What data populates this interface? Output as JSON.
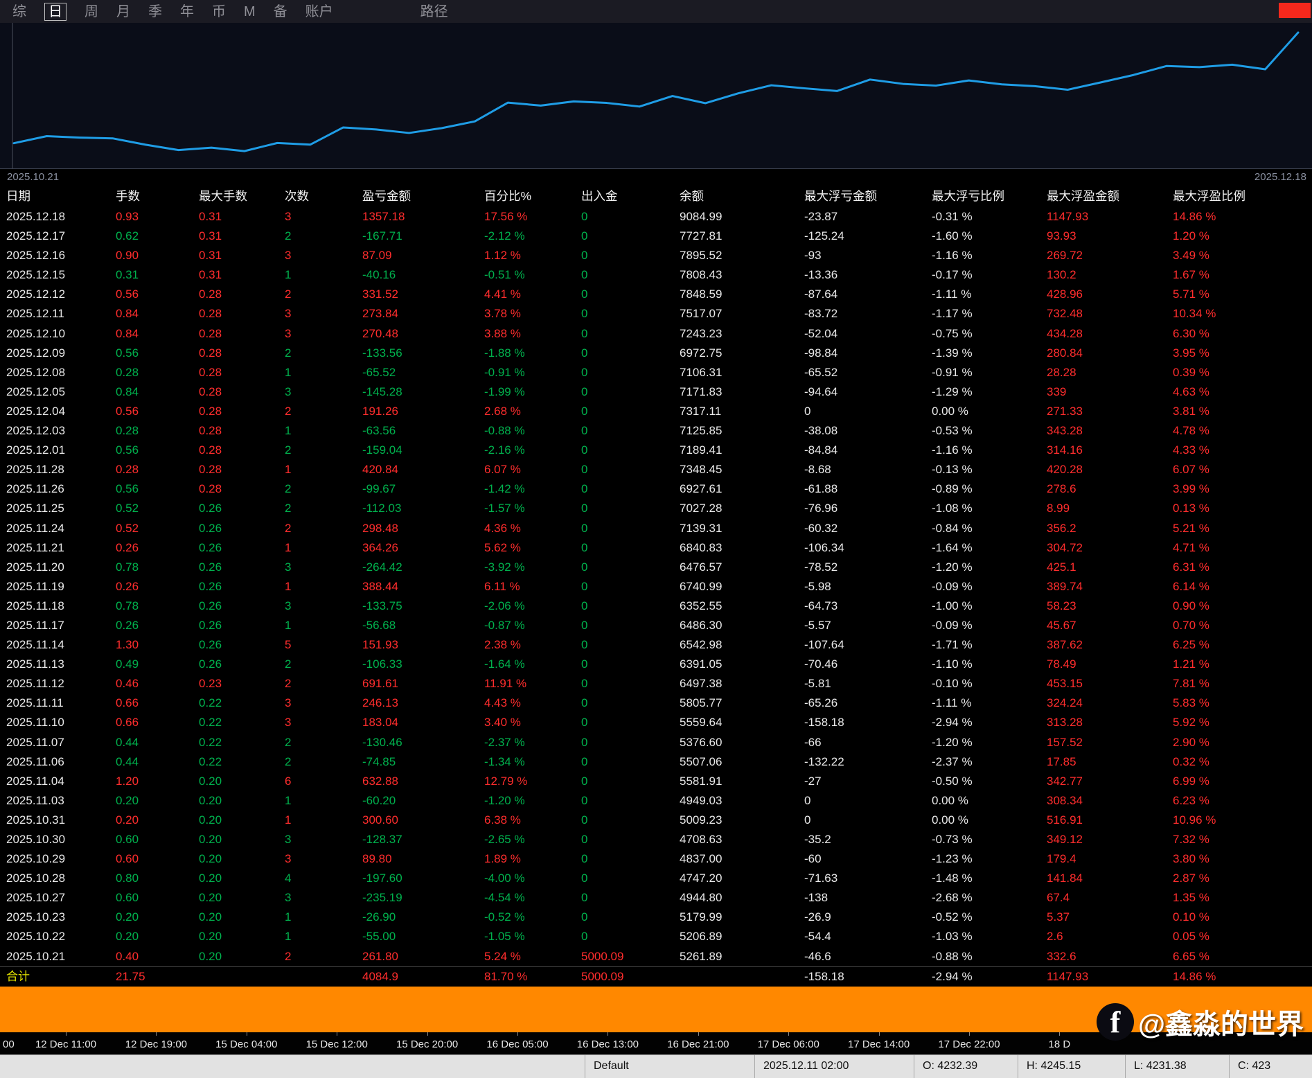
{
  "menu": {
    "items": [
      {
        "label": "综",
        "active": false
      },
      {
        "label": "日",
        "active": true
      },
      {
        "label": "周",
        "active": false
      },
      {
        "label": "月",
        "active": false
      },
      {
        "label": "季",
        "active": false
      },
      {
        "label": "年",
        "active": false
      },
      {
        "label": "币",
        "active": false
      },
      {
        "label": "M",
        "active": false
      },
      {
        "label": "备",
        "active": false
      },
      {
        "label": "账户",
        "active": false
      },
      {
        "label": "路径",
        "active": false,
        "gap": 100
      }
    ]
  },
  "chart": {
    "label_left": "2025.10.21",
    "label_right": "2025.12.18",
    "line_color": "#1f9de6"
  },
  "chart_data": {
    "type": "line",
    "name": "余额",
    "x_start": "2025.10.21",
    "x_end": "2025.12.18",
    "ylim": [
      4708.63,
      9084.99
    ],
    "values": [
      5000.09,
      5261.89,
      5206.89,
      5179.99,
      4944.8,
      4747.2,
      4837.0,
      4708.63,
      5009.23,
      4949.03,
      5581.91,
      5507.06,
      5376.6,
      5559.64,
      5805.77,
      6497.38,
      6391.05,
      6542.98,
      6486.3,
      6352.55,
      6740.99,
      6476.57,
      6840.83,
      7139.31,
      7027.28,
      6927.61,
      7348.45,
      7189.41,
      7125.85,
      7317.11,
      7171.83,
      7106.31,
      6972.75,
      7243.23,
      7517.07,
      7848.59,
      7808.43,
      7895.52,
      7727.81,
      9084.99
    ]
  },
  "table": {
    "keys": [
      "date",
      "lots",
      "max_lots",
      "count",
      "pnl",
      "pct",
      "deposit",
      "balance",
      "max_float_loss",
      "max_float_loss_pct",
      "max_float_profit",
      "max_float_profit_pct"
    ],
    "headers": [
      "日期",
      "手数",
      "最大手数",
      "次数",
      "盈亏金额",
      "百分比%",
      "出入金",
      "余额",
      "最大浮亏金额",
      "最大浮亏比例",
      "最大浮盈金额",
      "最大浮盈比例"
    ],
    "rows": [
      {
        "cells": [
          "2025.12.18",
          "0.93",
          "0.31",
          "3",
          "1357.18",
          "17.56 %",
          "0",
          "9084.99",
          "-23.87",
          "-0.31 %",
          "1147.93",
          "14.86 %"
        ],
        "colors": "wrrrrrgwwwrr"
      },
      {
        "cells": [
          "2025.12.17",
          "0.62",
          "0.31",
          "2",
          "-167.71",
          "-2.12 %",
          "0",
          "7727.81",
          "-125.24",
          "-1.60 %",
          "93.93",
          "1.20 %"
        ],
        "colors": "wgrggggwwwrr"
      },
      {
        "cells": [
          "2025.12.16",
          "0.90",
          "0.31",
          "3",
          "87.09",
          "1.12 %",
          "0",
          "7895.52",
          "-93",
          "-1.16 %",
          "269.72",
          "3.49 %"
        ],
        "colors": "wrrrrrgwwwrr"
      },
      {
        "cells": [
          "2025.12.15",
          "0.31",
          "0.31",
          "1",
          "-40.16",
          "-0.51 %",
          "0",
          "7808.43",
          "-13.36",
          "-0.17 %",
          "130.2",
          "1.67 %"
        ],
        "colors": "wgrggggwwwrr"
      },
      {
        "cells": [
          "2025.12.12",
          "0.56",
          "0.28",
          "2",
          "331.52",
          "4.41 %",
          "0",
          "7848.59",
          "-87.64",
          "-1.11 %",
          "428.96",
          "5.71 %"
        ],
        "colors": "wrrrrrgwwwrr"
      },
      {
        "cells": [
          "2025.12.11",
          "0.84",
          "0.28",
          "3",
          "273.84",
          "3.78 %",
          "0",
          "7517.07",
          "-83.72",
          "-1.17 %",
          "732.48",
          "10.34 %"
        ],
        "colors": "wrrrrrgwwwrr"
      },
      {
        "cells": [
          "2025.12.10",
          "0.84",
          "0.28",
          "3",
          "270.48",
          "3.88 %",
          "0",
          "7243.23",
          "-52.04",
          "-0.75 %",
          "434.28",
          "6.30 %"
        ],
        "colors": "wrrrrrgwwwrr"
      },
      {
        "cells": [
          "2025.12.09",
          "0.56",
          "0.28",
          "2",
          "-133.56",
          "-1.88 %",
          "0",
          "6972.75",
          "-98.84",
          "-1.39 %",
          "280.84",
          "3.95 %"
        ],
        "colors": "wgrggggwwwrr"
      },
      {
        "cells": [
          "2025.12.08",
          "0.28",
          "0.28",
          "1",
          "-65.52",
          "-0.91 %",
          "0",
          "7106.31",
          "-65.52",
          "-0.91 %",
          "28.28",
          "0.39 %"
        ],
        "colors": "wgrggggwwwrr"
      },
      {
        "cells": [
          "2025.12.05",
          "0.84",
          "0.28",
          "3",
          "-145.28",
          "-1.99 %",
          "0",
          "7171.83",
          "-94.64",
          "-1.29 %",
          "339",
          "4.63 %"
        ],
        "colors": "wgrggggwwwrr"
      },
      {
        "cells": [
          "2025.12.04",
          "0.56",
          "0.28",
          "2",
          "191.26",
          "2.68 %",
          "0",
          "7317.11",
          "0",
          "0.00 %",
          "271.33",
          "3.81 %"
        ],
        "colors": "wrrrrrgwwwrr"
      },
      {
        "cells": [
          "2025.12.03",
          "0.28",
          "0.28",
          "1",
          "-63.56",
          "-0.88 %",
          "0",
          "7125.85",
          "-38.08",
          "-0.53 %",
          "343.28",
          "4.78 %"
        ],
        "colors": "wgrggggwwwrr"
      },
      {
        "cells": [
          "2025.12.01",
          "0.56",
          "0.28",
          "2",
          "-159.04",
          "-2.16 %",
          "0",
          "7189.41",
          "-84.84",
          "-1.16 %",
          "314.16",
          "4.33 %"
        ],
        "colors": "wgrggggwwwrr"
      },
      {
        "cells": [
          "2025.11.28",
          "0.28",
          "0.28",
          "1",
          "420.84",
          "6.07 %",
          "0",
          "7348.45",
          "-8.68",
          "-0.13 %",
          "420.28",
          "6.07 %"
        ],
        "colors": "wrrrrrgwwwrr"
      },
      {
        "cells": [
          "2025.11.26",
          "0.56",
          "0.28",
          "2",
          "-99.67",
          "-1.42 %",
          "0",
          "6927.61",
          "-61.88",
          "-0.89 %",
          "278.6",
          "3.99 %"
        ],
        "colors": "wgrggggwwwrr"
      },
      {
        "cells": [
          "2025.11.25",
          "0.52",
          "0.26",
          "2",
          "-112.03",
          "-1.57 %",
          "0",
          "7027.28",
          "-76.96",
          "-1.08 %",
          "8.99",
          "0.13 %"
        ],
        "colors": "wggggggwwwrr"
      },
      {
        "cells": [
          "2025.11.24",
          "0.52",
          "0.26",
          "2",
          "298.48",
          "4.36 %",
          "0",
          "7139.31",
          "-60.32",
          "-0.84 %",
          "356.2",
          "5.21 %"
        ],
        "colors": "wrgrrrgwwwrr"
      },
      {
        "cells": [
          "2025.11.21",
          "0.26",
          "0.26",
          "1",
          "364.26",
          "5.62 %",
          "0",
          "6840.83",
          "-106.34",
          "-1.64 %",
          "304.72",
          "4.71 %"
        ],
        "colors": "wrgrrrgwwwrr"
      },
      {
        "cells": [
          "2025.11.20",
          "0.78",
          "0.26",
          "3",
          "-264.42",
          "-3.92 %",
          "0",
          "6476.57",
          "-78.52",
          "-1.20 %",
          "425.1",
          "6.31 %"
        ],
        "colors": "wggggggwwwrr"
      },
      {
        "cells": [
          "2025.11.19",
          "0.26",
          "0.26",
          "1",
          "388.44",
          "6.11 %",
          "0",
          "6740.99",
          "-5.98",
          "-0.09 %",
          "389.74",
          "6.14 %"
        ],
        "colors": "wrgrrrgwwwrr"
      },
      {
        "cells": [
          "2025.11.18",
          "0.78",
          "0.26",
          "3",
          "-133.75",
          "-2.06 %",
          "0",
          "6352.55",
          "-64.73",
          "-1.00 %",
          "58.23",
          "0.90 %"
        ],
        "colors": "wggggggwwwrr"
      },
      {
        "cells": [
          "2025.11.17",
          "0.26",
          "0.26",
          "1",
          "-56.68",
          "-0.87 %",
          "0",
          "6486.30",
          "-5.57",
          "-0.09 %",
          "45.67",
          "0.70 %"
        ],
        "colors": "wggggggwwwrr"
      },
      {
        "cells": [
          "2025.11.14",
          "1.30",
          "0.26",
          "5",
          "151.93",
          "2.38 %",
          "0",
          "6542.98",
          "-107.64",
          "-1.71 %",
          "387.62",
          "6.25 %"
        ],
        "colors": "wrgrrrgwwwrr"
      },
      {
        "cells": [
          "2025.11.13",
          "0.49",
          "0.26",
          "2",
          "-106.33",
          "-1.64 %",
          "0",
          "6391.05",
          "-70.46",
          "-1.10 %",
          "78.49",
          "1.21 %"
        ],
        "colors": "wggggggwwwrr"
      },
      {
        "cells": [
          "2025.11.12",
          "0.46",
          "0.23",
          "2",
          "691.61",
          "11.91 %",
          "0",
          "6497.38",
          "-5.81",
          "-0.10 %",
          "453.15",
          "7.81 %"
        ],
        "colors": "wrrrrrgwwwrr"
      },
      {
        "cells": [
          "2025.11.11",
          "0.66",
          "0.22",
          "3",
          "246.13",
          "4.43 %",
          "0",
          "5805.77",
          "-65.26",
          "-1.11 %",
          "324.24",
          "5.83 %"
        ],
        "colors": "wrgrrrgwwwrr"
      },
      {
        "cells": [
          "2025.11.10",
          "0.66",
          "0.22",
          "3",
          "183.04",
          "3.40 %",
          "0",
          "5559.64",
          "-158.18",
          "-2.94 %",
          "313.28",
          "5.92 %"
        ],
        "colors": "wrgrrrgwwwrr"
      },
      {
        "cells": [
          "2025.11.07",
          "0.44",
          "0.22",
          "2",
          "-130.46",
          "-2.37 %",
          "0",
          "5376.60",
          "-66",
          "-1.20 %",
          "157.52",
          "2.90 %"
        ],
        "colors": "wggggggwwwrr"
      },
      {
        "cells": [
          "2025.11.06",
          "0.44",
          "0.22",
          "2",
          "-74.85",
          "-1.34 %",
          "0",
          "5507.06",
          "-132.22",
          "-2.37 %",
          "17.85",
          "0.32 %"
        ],
        "colors": "wggggggwwwrr"
      },
      {
        "cells": [
          "2025.11.04",
          "1.20",
          "0.20",
          "6",
          "632.88",
          "12.79 %",
          "0",
          "5581.91",
          "-27",
          "-0.50 %",
          "342.77",
          "6.99 %"
        ],
        "colors": "wrgrrrgwwwrr"
      },
      {
        "cells": [
          "2025.11.03",
          "0.20",
          "0.20",
          "1",
          "-60.20",
          "-1.20 %",
          "0",
          "4949.03",
          "0",
          "0.00 %",
          "308.34",
          "6.23 %"
        ],
        "colors": "wggggggwwwrr"
      },
      {
        "cells": [
          "2025.10.31",
          "0.20",
          "0.20",
          "1",
          "300.60",
          "6.38 %",
          "0",
          "5009.23",
          "0",
          "0.00 %",
          "516.91",
          "10.96 %"
        ],
        "colors": "wrgrrrgwwwrr"
      },
      {
        "cells": [
          "2025.10.30",
          "0.60",
          "0.20",
          "3",
          "-128.37",
          "-2.65 %",
          "0",
          "4708.63",
          "-35.2",
          "-0.73 %",
          "349.12",
          "7.32 %"
        ],
        "colors": "wggggggwwwrr"
      },
      {
        "cells": [
          "2025.10.29",
          "0.60",
          "0.20",
          "3",
          "89.80",
          "1.89 %",
          "0",
          "4837.00",
          "-60",
          "-1.23 %",
          "179.4",
          "3.80 %"
        ],
        "colors": "wrgrrrgwwwrr"
      },
      {
        "cells": [
          "2025.10.28",
          "0.80",
          "0.20",
          "4",
          "-197.60",
          "-4.00 %",
          "0",
          "4747.20",
          "-71.63",
          "-1.48 %",
          "141.84",
          "2.87 %"
        ],
        "colors": "wggggggwwwrr"
      },
      {
        "cells": [
          "2025.10.27",
          "0.60",
          "0.20",
          "3",
          "-235.19",
          "-4.54 %",
          "0",
          "4944.80",
          "-138",
          "-2.68 %",
          "67.4",
          "1.35 %"
        ],
        "colors": "wggggggwwwrr"
      },
      {
        "cells": [
          "2025.10.23",
          "0.20",
          "0.20",
          "1",
          "-26.90",
          "-0.52 %",
          "0",
          "5179.99",
          "-26.9",
          "-0.52 %",
          "5.37",
          "0.10 %"
        ],
        "colors": "wggggggwwwrr"
      },
      {
        "cells": [
          "2025.10.22",
          "0.20",
          "0.20",
          "1",
          "-55.00",
          "-1.05 %",
          "0",
          "5206.89",
          "-54.4",
          "-1.03 %",
          "2.6",
          "0.05 %"
        ],
        "colors": "wggggggwwwrr"
      },
      {
        "cells": [
          "2025.10.21",
          "0.40",
          "0.20",
          "2",
          "261.80",
          "5.24 %",
          "5000.09",
          "5261.89",
          "-46.6",
          "-0.88 %",
          "332.6",
          "6.65 %"
        ],
        "colors": "wrgrrrrwwwrr"
      },
      {
        "cells": [
          "合计",
          "21.75",
          "",
          "",
          "4084.9",
          "81.70 %",
          "5000.09",
          "",
          "-158.18",
          "-2.94 %",
          "1147.93",
          "14.86 %"
        ],
        "colors": "yrwwrrrwwwrr",
        "total": true
      }
    ]
  },
  "timeline": {
    "labels": [
      "00",
      "12 Dec 11:00",
      "12 Dec 19:00",
      "15 Dec 04:00",
      "15 Dec 12:00",
      "15 Dec 20:00",
      "16 Dec 05:00",
      "16 Dec 13:00",
      "16 Dec 21:00",
      "17 Dec 06:00",
      "17 Dec 14:00",
      "17 Dec 22:00",
      "18 D"
    ]
  },
  "status_bar": {
    "cells": [
      "",
      "Default",
      "2025.12.11 02:00",
      "O: 4232.39",
      "H: 4245.15",
      "L: 4231.38",
      "C: 423"
    ],
    "names": [
      "status-empty",
      "status-template",
      "status-datetime",
      "status-open",
      "status-high",
      "status-low",
      "status-close"
    ]
  },
  "watermark": {
    "text": "@鑫淼的世界"
  }
}
